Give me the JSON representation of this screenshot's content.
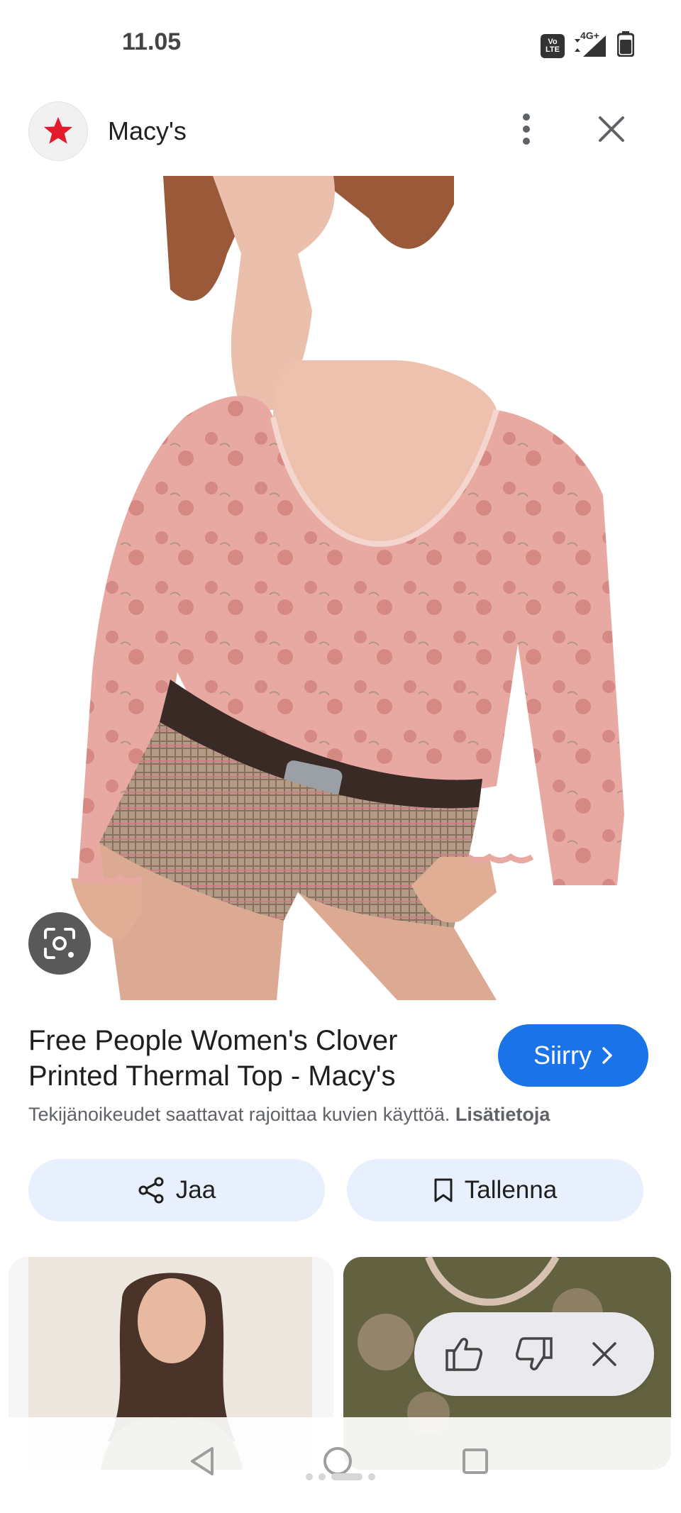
{
  "status_bar": {
    "time": "11.05",
    "volte_label": "Vo LTE",
    "network_label": "4G+"
  },
  "header": {
    "site_name": "Macy's",
    "logo_icon": "macys-star-icon"
  },
  "product": {
    "title_line1": "Free People Women's Clover",
    "title_line2": "Printed Thermal Top - Macy's",
    "go_label": "Siirry",
    "copyright_text": "Tekijänoikeudet saattavat rajoittaa kuvien käyttöä. ",
    "learn_more": "Lisätietoja"
  },
  "actions": {
    "share_label": "Jaa",
    "save_label": "Tallenna"
  },
  "colors": {
    "primary": "#1a73e8",
    "action_bg": "#e8f0fe",
    "macys_red": "#e21a2c",
    "top_pink": "#e8a5a0",
    "shorts_tan": "#a68a78"
  }
}
